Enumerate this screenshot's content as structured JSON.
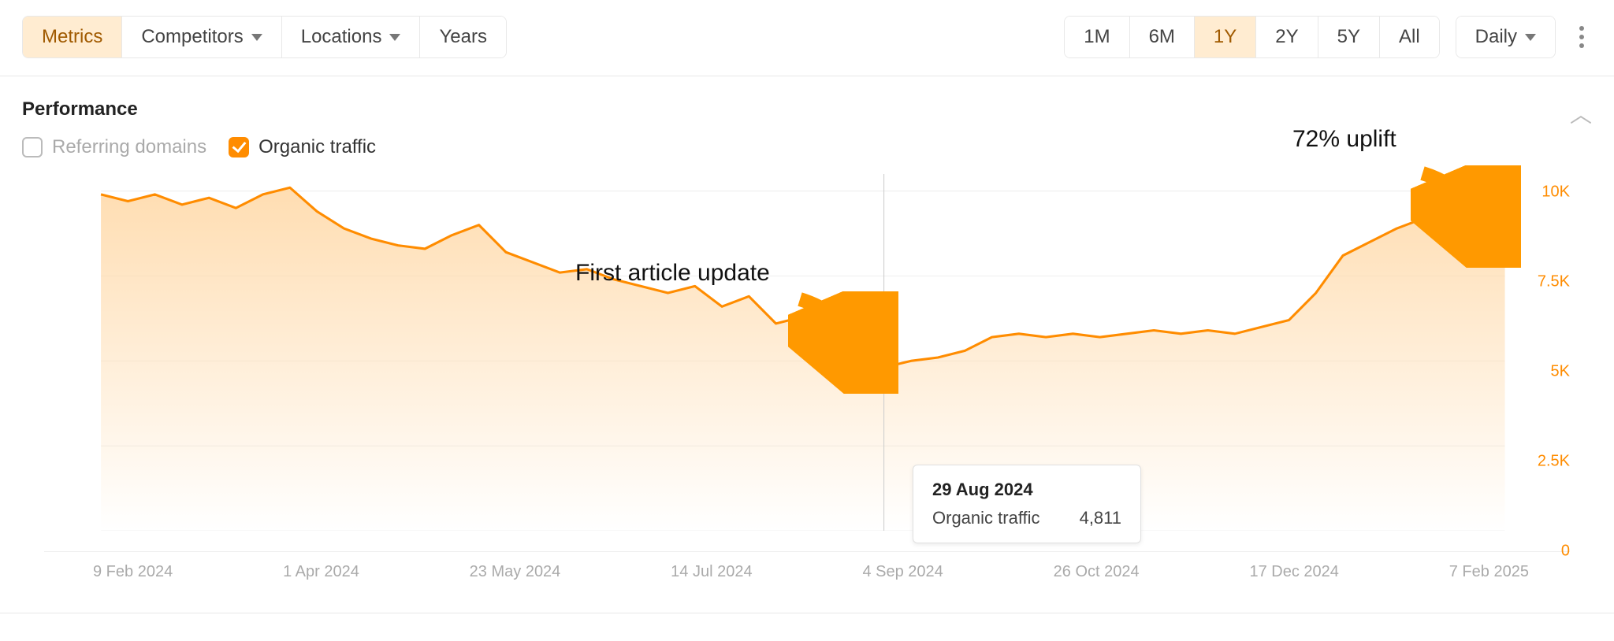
{
  "toolbar": {
    "tabs": [
      {
        "label": "Metrics",
        "active": true,
        "dropdown": false
      },
      {
        "label": "Competitors",
        "active": false,
        "dropdown": true
      },
      {
        "label": "Locations",
        "active": false,
        "dropdown": true
      },
      {
        "label": "Years",
        "active": false,
        "dropdown": false
      }
    ],
    "ranges": [
      {
        "label": "1M",
        "active": false
      },
      {
        "label": "6M",
        "active": false
      },
      {
        "label": "1Y",
        "active": true
      },
      {
        "label": "2Y",
        "active": false
      },
      {
        "label": "5Y",
        "active": false
      },
      {
        "label": "All",
        "active": false
      }
    ],
    "granularity": {
      "label": "Daily"
    }
  },
  "panel": {
    "title": "Performance",
    "legend": [
      {
        "label": "Referring domains",
        "checked": false
      },
      {
        "label": "Organic traffic",
        "checked": true
      }
    ]
  },
  "tooltip": {
    "date": "29 Aug 2024",
    "metric_label": "Organic traffic",
    "metric_value": "4,811"
  },
  "annotations": {
    "first_update": "First article update",
    "uplift": "72% uplift"
  },
  "chart_data": {
    "type": "area",
    "title": "Performance",
    "series_name": "Organic traffic",
    "ylabel": "",
    "xlabel": "",
    "ylim": [
      0,
      10500
    ],
    "y_ticks": [
      0,
      2500,
      5000,
      7500,
      10000
    ],
    "y_tick_labels": [
      "0",
      "2.5K",
      "5K",
      "7.5K",
      "10K"
    ],
    "x_tick_labels": [
      "9 Feb 2024",
      "1 Apr 2024",
      "23 May 2024",
      "14 Jul 2024",
      "4 Sep 2024",
      "26 Oct 2024",
      "17 Dec 2024",
      "7 Feb 2025"
    ],
    "highlight": {
      "x": "29 Aug 2024",
      "y": 4811
    },
    "x": [
      "9 Feb 2024",
      "16 Feb 2024",
      "23 Feb 2024",
      "1 Mar 2024",
      "8 Mar 2024",
      "15 Mar 2024",
      "22 Mar 2024",
      "29 Mar 2024",
      "5 Apr 2024",
      "12 Apr 2024",
      "19 Apr 2024",
      "26 Apr 2024",
      "3 May 2024",
      "10 May 2024",
      "17 May 2024",
      "23 May 2024",
      "31 May 2024",
      "7 Jun 2024",
      "14 Jun 2024",
      "21 Jun 2024",
      "28 Jun 2024",
      "5 Jul 2024",
      "14 Jul 2024",
      "21 Jul 2024",
      "28 Jul 2024",
      "4 Aug 2024",
      "11 Aug 2024",
      "18 Aug 2024",
      "25 Aug 2024",
      "29 Aug 2024",
      "4 Sep 2024",
      "11 Sep 2024",
      "18 Sep 2024",
      "25 Sep 2024",
      "2 Oct 2024",
      "9 Oct 2024",
      "16 Oct 2024",
      "26 Oct 2024",
      "2 Nov 2024",
      "9 Nov 2024",
      "16 Nov 2024",
      "23 Nov 2024",
      "30 Nov 2024",
      "7 Dec 2024",
      "17 Dec 2024",
      "24 Dec 2024",
      "31 Dec 2024",
      "7 Jan 2025",
      "14 Jan 2025",
      "21 Jan 2025",
      "28 Jan 2025",
      "4 Feb 2025",
      "7 Feb 2025"
    ],
    "y": [
      9900,
      9700,
      9900,
      9600,
      9800,
      9500,
      9900,
      10100,
      9400,
      8900,
      8600,
      8400,
      8300,
      8700,
      9000,
      8200,
      7900,
      7600,
      7700,
      7400,
      7200,
      7000,
      7200,
      6600,
      6900,
      6100,
      6300,
      5800,
      5400,
      4811,
      5000,
      5100,
      5300,
      5700,
      5800,
      5700,
      5800,
      5700,
      5800,
      5900,
      5800,
      5900,
      5800,
      6000,
      6200,
      7000,
      8100,
      8500,
      8900,
      9200,
      9500,
      10200,
      9200
    ]
  }
}
